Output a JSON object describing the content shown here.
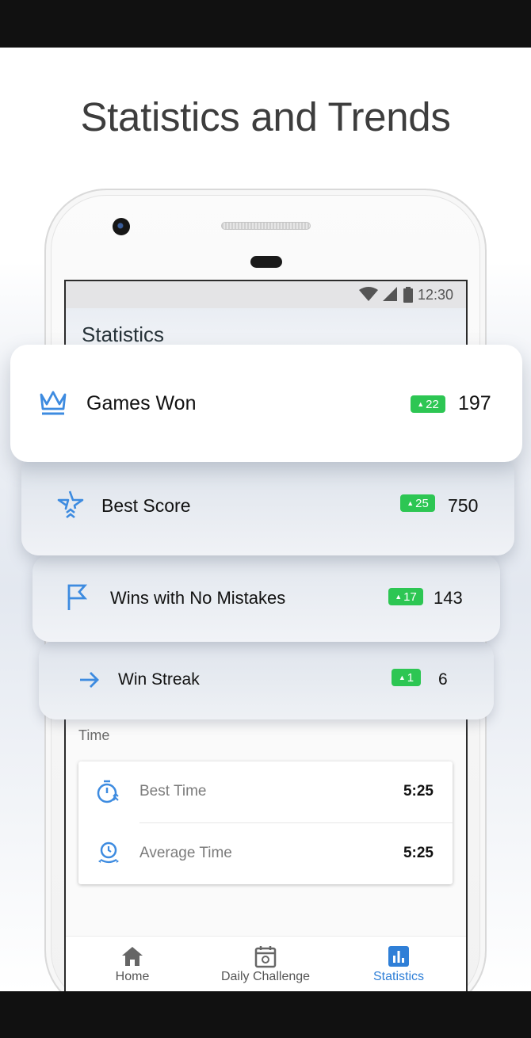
{
  "headline": "Statistics and Trends",
  "status_bar": {
    "time": "12:30",
    "icons": [
      "wifi-icon",
      "signal-icon",
      "battery-icon"
    ]
  },
  "screen": {
    "title": "Statistics"
  },
  "stats": [
    {
      "label": "Games Won",
      "badge": "22",
      "value": "197",
      "icon": "crown-icon"
    },
    {
      "label": "Best Score",
      "badge": "25",
      "value": "750",
      "icon": "star-icon"
    },
    {
      "label": "Wins with No Mistakes",
      "badge": "17",
      "value": "143",
      "icon": "flag-icon"
    },
    {
      "label": "Win Streak",
      "badge": "1",
      "value": "6",
      "icon": "arrow-right-icon"
    }
  ],
  "time_section": {
    "label": "Time",
    "rows": [
      {
        "label": "Best Time",
        "value": "5:25",
        "icon": "stopwatch-icon"
      },
      {
        "label": "Average Time",
        "value": "5:25",
        "icon": "average-time-icon"
      }
    ]
  },
  "nav": [
    {
      "label": "Home",
      "icon": "home-icon",
      "active": false
    },
    {
      "label": "Daily Challenge",
      "icon": "calendar-icon",
      "active": false
    },
    {
      "label": "Statistics",
      "icon": "bar-chart-icon",
      "active": true
    }
  ],
  "colors": {
    "accent": "#2f7fd7",
    "badge": "#2dc653",
    "icon_blue": "#3d8be0"
  }
}
